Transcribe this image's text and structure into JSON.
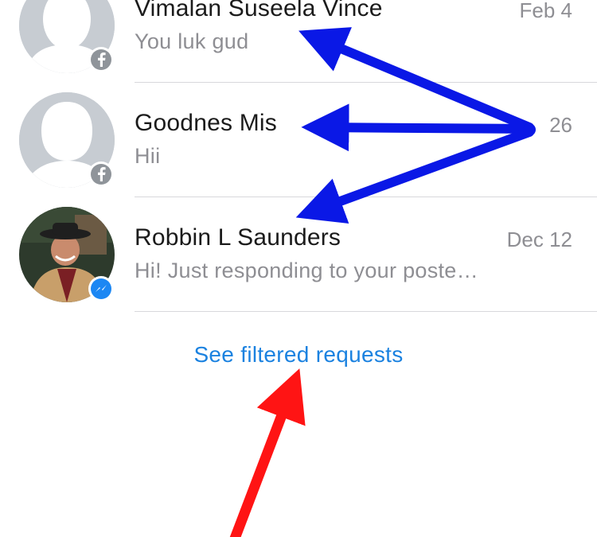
{
  "conversations": [
    {
      "name": "Vimalan Suseela Vince",
      "preview": "You luk gud",
      "date": "Feb 4",
      "avatar": "default-avatar",
      "badge": "facebook-icon"
    },
    {
      "name": "Goodnes Mis",
      "preview": "Hii",
      "date": "26",
      "avatar": "default-avatar",
      "badge": "facebook-icon"
    },
    {
      "name": "Robbin L Saunders",
      "preview": "Hi!  Just responding to your poste…",
      "date": "Dec 12",
      "avatar": "photo-avatar",
      "badge": "messenger-icon"
    }
  ],
  "filtered_link": "See filtered requests",
  "colors": {
    "link": "#1b82e0",
    "annotation_blue": "#0a18e6",
    "annotation_red": "#ff1414",
    "messenger_badge": "#1c87f3",
    "facebook_badge": "#8f949a"
  }
}
